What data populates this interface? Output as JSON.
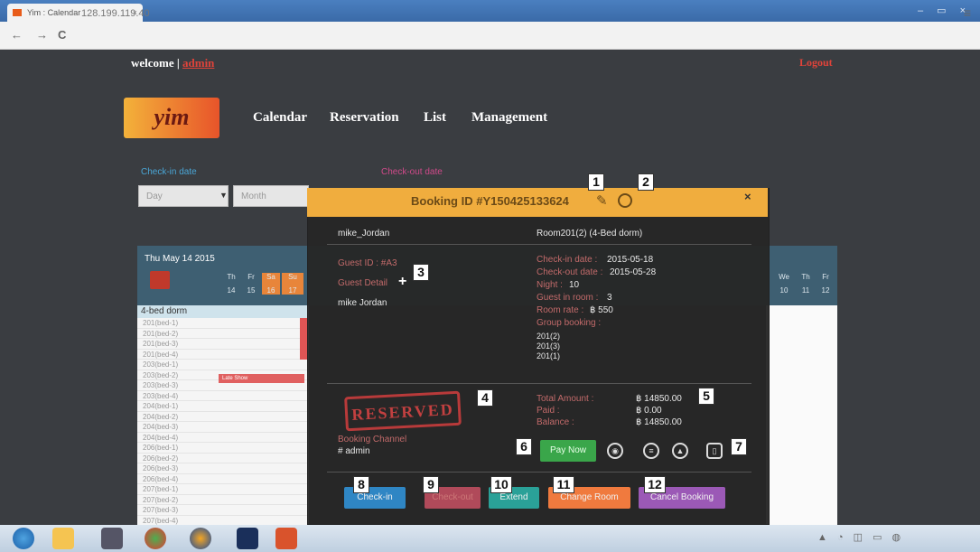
{
  "browser": {
    "tab_title": "Yim : Calendar",
    "tab_close": "×",
    "window_controls": "– ▭ ×",
    "back": "←",
    "forward": "→",
    "reload": "C",
    "url": "128.199.119.40",
    "menu": "≡"
  },
  "header": {
    "welcome": "welcome |",
    "user": "admin",
    "logout": "Logout",
    "logo": "yim"
  },
  "nav": [
    "Calendar",
    "Reservation",
    "List",
    "Management"
  ],
  "filters": {
    "checkin_label": "Check-in date",
    "checkout_label": "Check-out date",
    "day_placeholder": "Day",
    "month_placeholder": "Month"
  },
  "calendar": {
    "date": "Thu May 14 2015",
    "left_days": [
      {
        "d": "Th",
        "n": "14"
      },
      {
        "d": "Fr",
        "n": "15"
      },
      {
        "d": "Sa",
        "n": "16"
      },
      {
        "d": "Su",
        "n": "17"
      }
    ],
    "right_days": [
      {
        "d": "We",
        "n": "10"
      },
      {
        "d": "Th",
        "n": "11"
      },
      {
        "d": "Fr",
        "n": "12"
      }
    ],
    "room_type": "4-bed dorm",
    "beds": [
      "201(bed-1)",
      "201(bed-2)",
      "201(bed-3)",
      "201(bed-4)",
      "203(bed-1)",
      "203(bed-2)",
      "203(bed-3)",
      "203(bed-4)",
      "204(bed-1)",
      "204(bed-2)",
      "204(bed-3)",
      "204(bed-4)",
      "206(bed-1)",
      "206(bed-2)",
      "206(bed-3)",
      "206(bed-4)",
      "207(bed-1)",
      "207(bed-2)",
      "207(bed-3)",
      "207(bed-4)"
    ],
    "late_show": "Late Show"
  },
  "modal": {
    "title": "Booking ID #Y150425133624",
    "close": "×",
    "guest_name": "mike_Jordan",
    "room": "Room201(2) (4-Bed dorm)",
    "guest_id_label": "Guest ID : #A3",
    "guest_detail_label": "Guest Detail",
    "add": "+",
    "guest_detail_name": "mike Jordan",
    "checkin_label": "Check-in date :",
    "checkin": "2015-05-18",
    "checkout_label": "Check-out date :",
    "checkout": "2015-05-28",
    "night_label": "Night :",
    "night": "10",
    "guests_label": "Guest in room :",
    "guests": "3",
    "rate_label": "Room rate :",
    "rate": "฿ 550",
    "group_label": "Group booking :",
    "group": [
      "201(2)",
      "201(3)",
      "201(1)"
    ],
    "stamp": "RESERVED",
    "total_label": "Total Amount :",
    "total": "฿ 14850.00",
    "paid_label": "Paid :",
    "paid": "฿ 0.00",
    "balance_label": "Balance :",
    "balance": "฿ 14850.00",
    "channel_label": "Booking Channel",
    "channel": "# admin",
    "pay_now": "Pay Now",
    "buttons": {
      "checkin": "Check-in",
      "checkout": "Check-out",
      "extend": "Extend",
      "change_room": "Change Room",
      "cancel_booking": "Cancel Booking"
    }
  },
  "markers": [
    "1",
    "2",
    "3",
    "4",
    "5",
    "6",
    "7",
    "8",
    "9",
    "10",
    "11",
    "12"
  ],
  "colors": {
    "accent": "#f0ad3e",
    "danger": "#c0392b",
    "pay": "#3aa64a",
    "checkin_btn": "#2f86c4",
    "checkout_btn": "#b04a5a",
    "extend_btn": "#2aa198",
    "change_btn": "#f07a3e",
    "cancel_btn": "#9b59b6"
  }
}
